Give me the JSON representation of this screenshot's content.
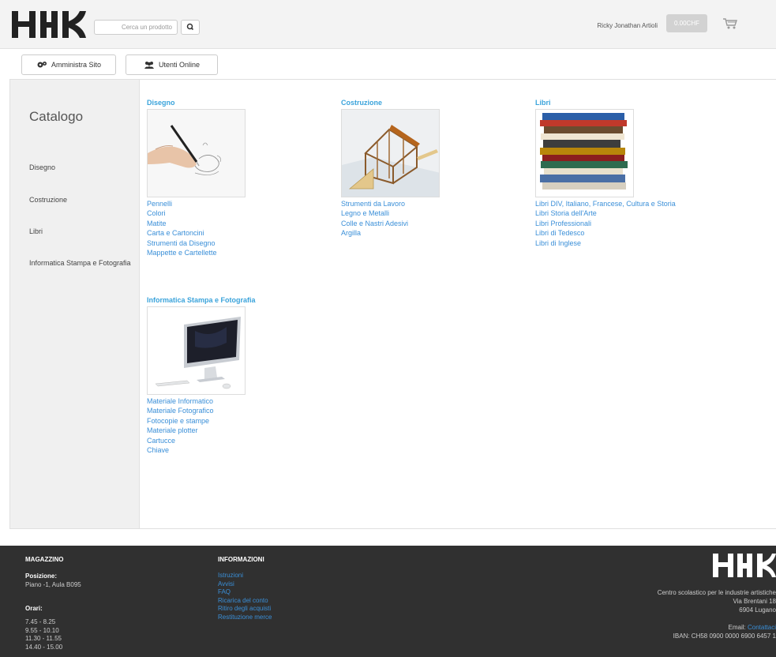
{
  "header": {
    "search_placeholder": "Cerca un prodotto",
    "user_name": "Ricky Jonathan Artioli",
    "balance": "0.00CHF"
  },
  "admin_bar": {
    "admin_label": "Amministra Sito",
    "online_label": "Utenti Online"
  },
  "sidebar": {
    "title": "Catalogo",
    "items": [
      {
        "label": "Disegno"
      },
      {
        "label": "Costruzione"
      },
      {
        "label": "Libri"
      },
      {
        "label": "Informatica Stampa e Fotografia"
      }
    ]
  },
  "categories": [
    {
      "title": "Disegno",
      "image_icon": "drawing-hand-icon",
      "subcategories": [
        "Pennelli",
        "Colori",
        "Matite",
        "Carta e Cartoncini",
        "Strumenti da Disegno",
        "Mappette e Cartellette"
      ]
    },
    {
      "title": "Costruzione",
      "image_icon": "house-construction-icon",
      "subcategories": [
        "Strumenti da Lavoro",
        "Legno e Metalli",
        "Colle e Nastri Adesivi",
        "Argilla"
      ]
    },
    {
      "title": "Libri",
      "image_icon": "book-stack-icon",
      "subcategories": [
        "Libri DIV, Italiano, Francese, Cultura e Storia",
        "Libri Storia dell'Arte",
        "Libri Professionali",
        "Libri di Tedesco",
        "Libri di Inglese"
      ]
    },
    {
      "title": "Informatica Stampa e Fotografia",
      "image_icon": "computer-monitor-icon",
      "subcategories": [
        "Materiale Informatico",
        "Materiale Fotografico",
        "Fotocopie e stampe",
        "Materiale plotter",
        "Cartucce",
        "Chiave"
      ]
    }
  ],
  "footer": {
    "magazzino": {
      "heading": "MAGAZZINO",
      "position_label": "Posizione:",
      "position_value": "Piano -1, Aula B095",
      "hours_label": "Orari:",
      "hours": [
        "7.45 - 8.25",
        "9.55 - 10.10",
        "11.30 - 11.55",
        "14.40 - 15.00"
      ]
    },
    "informazioni": {
      "heading": "INFORMAZIONI",
      "links": [
        "Istruzioni",
        "Avvisi",
        "FAQ",
        "Ricarica del conto",
        "Ritiro degli acquisti",
        "Restituzione merce"
      ]
    },
    "school": {
      "name": "Centro scolastico per le industrie artistiche",
      "street": "Via Brentani 18",
      "city": "6904 Lugano",
      "email_label": "Email:",
      "email_link": "Contattaci",
      "iban": "IBAN: CH58 0900 0000 6900 6457 1"
    }
  },
  "colors": {
    "accent": "#3aa3db",
    "link": "#3a8fd8",
    "footer_bg": "#303030",
    "sidebar_bg": "#f0f0f0"
  }
}
